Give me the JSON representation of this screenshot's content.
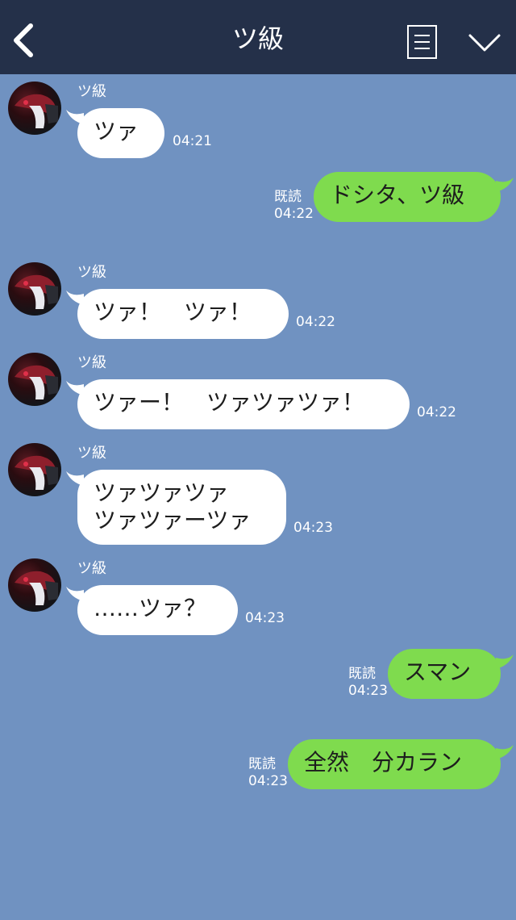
{
  "header": {
    "title": "ツ級",
    "colors": {
      "header_bg": "#243049",
      "chat_bg": "#7092c1",
      "outgoing_bubble": "#7fdb4e",
      "incoming_bubble": "#ffffff"
    }
  },
  "messages": [
    {
      "direction": "in",
      "sender": "ツ級",
      "text": "ツァ",
      "time": "04:21"
    },
    {
      "direction": "out",
      "read": "既読",
      "text": "ドシタ、ツ級",
      "time": "04:22"
    },
    {
      "direction": "in",
      "sender": "ツ級",
      "text": "ツァ！　ツァ！",
      "time": "04:22"
    },
    {
      "direction": "in",
      "sender": "ツ級",
      "text": "ツァー！　ツァツァツァ！",
      "time": "04:22"
    },
    {
      "direction": "in",
      "sender": "ツ級",
      "text_line1": "ツァツァツァ",
      "text_line2": "ツァツァーツァ",
      "time": "04:23"
    },
    {
      "direction": "in",
      "sender": "ツ級",
      "text": "……ツァ？",
      "time": "04:23"
    },
    {
      "direction": "out",
      "read": "既読",
      "text": "スマン",
      "time": "04:23"
    },
    {
      "direction": "out",
      "read": "既読",
      "text": "全然　分カラン",
      "time": "04:23"
    }
  ]
}
